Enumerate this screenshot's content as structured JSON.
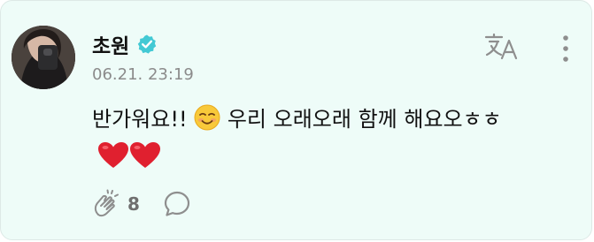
{
  "post": {
    "author_name": "초원",
    "timestamp": "06.21. 23:19",
    "message_text": "반가워요!! ",
    "message_text_2": " 우리 오래오래 함께 해요오ㅎㅎ ",
    "like_count": "8"
  },
  "icons": {
    "verified": "verified-badge-icon",
    "translate": "translate-icon",
    "more": "more-vertical-icon",
    "like": "clap-like-icon",
    "comment": "comment-bubble-icon",
    "emoji": "smiling-face-emoji",
    "hearts": "red-heart-emoji"
  },
  "colors": {
    "card_background": "#eefcf8",
    "verified_badge": "#42c9d4",
    "heart": "#e0202f",
    "icon_gray": "#8e8e8e"
  }
}
